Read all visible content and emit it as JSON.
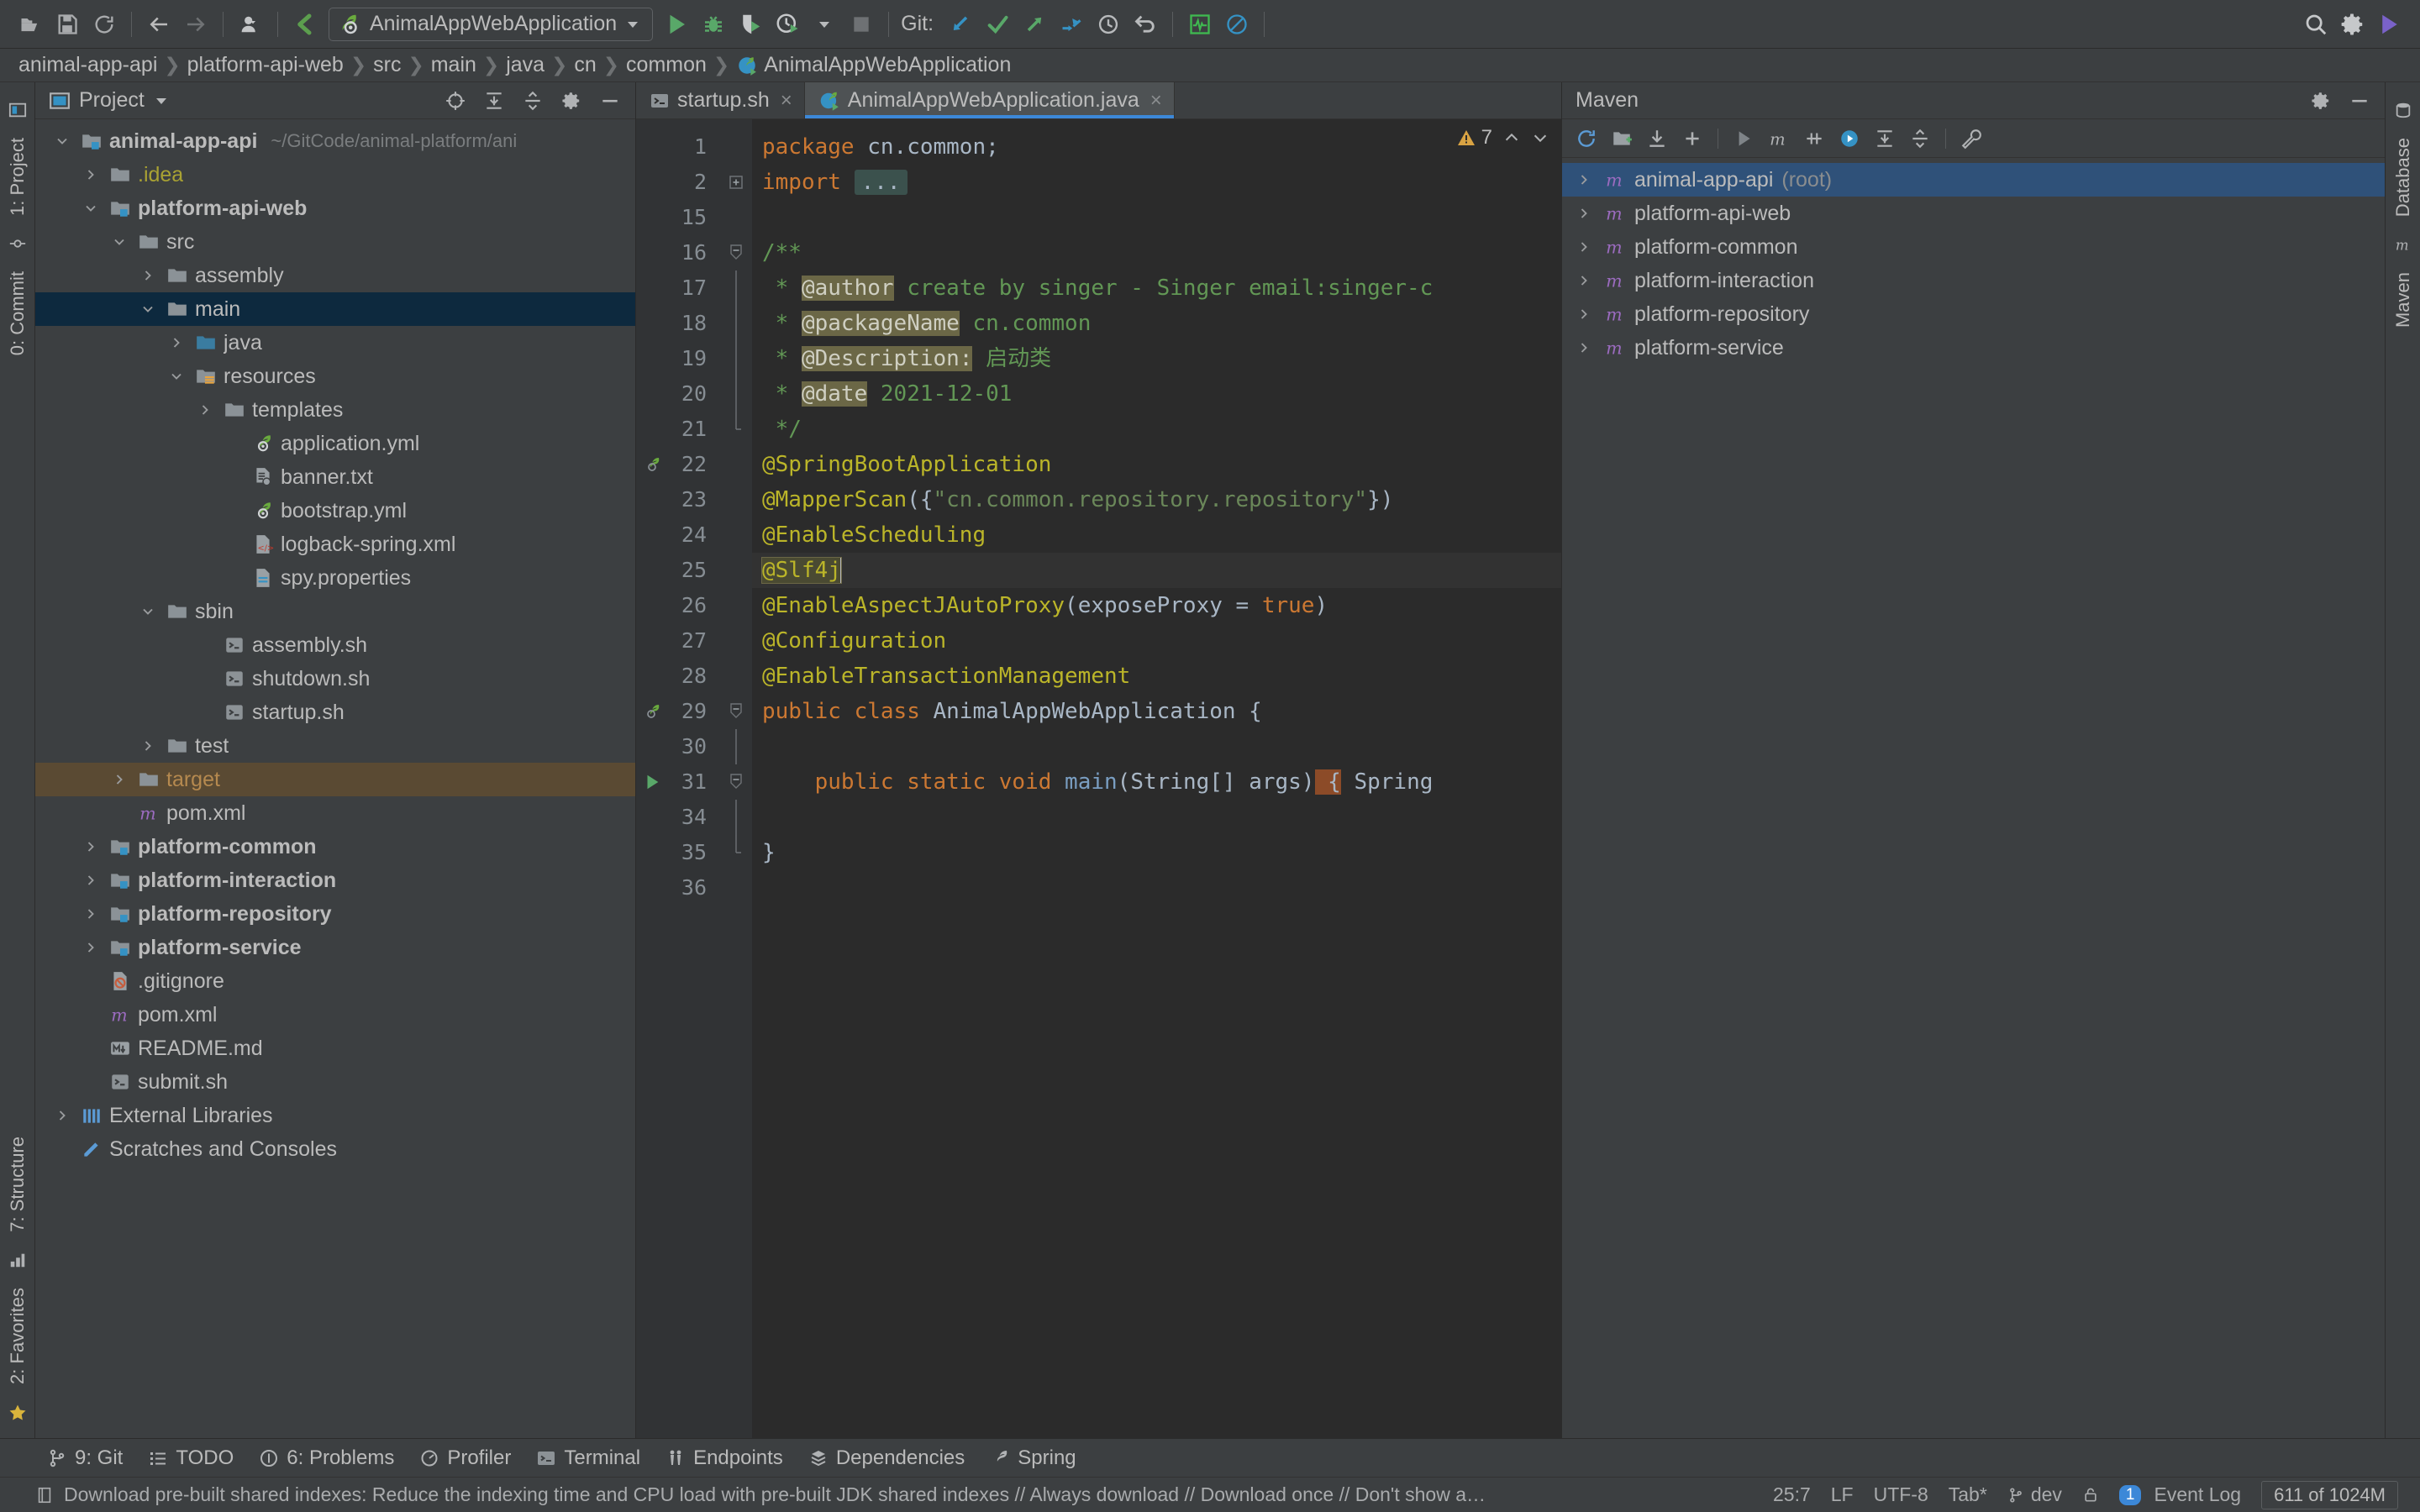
{
  "toolbar": {
    "icons": [
      "open-folder-icon",
      "save-icon",
      "sync-icon",
      "back-arrow-icon",
      "forward-arrow-icon",
      "user-avatar-icon",
      "vcs-update-icon"
    ],
    "run_config": "AnimalAppWebApplication",
    "run_label": "Run",
    "debug_label": "Debug",
    "coverage_label": "Run with Coverage",
    "profile_label": "Profile",
    "stop_label": "Stop",
    "git_label": "Git:",
    "search_label": "Search Everywhere",
    "settings_label": "Settings",
    "updates_label": "Updates"
  },
  "breadcrumb": {
    "items": [
      {
        "label": "animal-app-api",
        "icon": ""
      },
      {
        "label": "platform-api-web",
        "icon": ""
      },
      {
        "label": "src",
        "icon": ""
      },
      {
        "label": "main",
        "icon": ""
      },
      {
        "label": "java",
        "icon": ""
      },
      {
        "label": "cn",
        "icon": ""
      },
      {
        "label": "common",
        "icon": ""
      },
      {
        "label": "AnimalAppWebApplication",
        "icon": "spring-class-icon"
      }
    ],
    "separator": "❯"
  },
  "left_strip": {
    "project_label": "1: Project",
    "commit_label": "0: Commit",
    "structure_label": "7: Structure",
    "favorites_label": "2: Favorites"
  },
  "right_strip": {
    "database_label": "Database",
    "maven_label": "Maven"
  },
  "project_panel": {
    "title": "Project",
    "toolbar_icons": [
      "locate-icon",
      "expand-all-icon",
      "collapse-all-icon",
      "gear-icon",
      "hide-icon"
    ],
    "tree": [
      {
        "label": "animal-app-api",
        "sub": "~/GitCode/animal-platform/ani",
        "depth": 0,
        "twisty": "open",
        "icon": "module-folder-icon",
        "bold": true
      },
      {
        "label": ".idea",
        "sub": "",
        "depth": 1,
        "twisty": "closed",
        "icon": "folder-icon",
        "color": "yellow"
      },
      {
        "label": "platform-api-web",
        "sub": "",
        "depth": 1,
        "twisty": "open",
        "icon": "module-folder-icon",
        "bold": true
      },
      {
        "label": "src",
        "sub": "",
        "depth": 2,
        "twisty": "open",
        "icon": "folder-icon"
      },
      {
        "label": "assembly",
        "sub": "",
        "depth": 3,
        "twisty": "closed",
        "icon": "folder-icon"
      },
      {
        "label": "main",
        "sub": "",
        "depth": 3,
        "twisty": "open",
        "icon": "folder-icon",
        "selected": true
      },
      {
        "label": "java",
        "sub": "",
        "depth": 4,
        "twisty": "closed",
        "icon": "source-folder-icon"
      },
      {
        "label": "resources",
        "sub": "",
        "depth": 4,
        "twisty": "open",
        "icon": "resource-folder-icon"
      },
      {
        "label": "templates",
        "sub": "",
        "depth": 5,
        "twisty": "closed",
        "icon": "folder-icon"
      },
      {
        "label": "application.yml",
        "sub": "",
        "depth": 6,
        "twisty": "none",
        "icon": "spring-yaml-icon"
      },
      {
        "label": "banner.txt",
        "sub": "",
        "depth": 6,
        "twisty": "none",
        "icon": "text-file-icon"
      },
      {
        "label": "bootstrap.yml",
        "sub": "",
        "depth": 6,
        "twisty": "none",
        "icon": "spring-yaml-icon"
      },
      {
        "label": "logback-spring.xml",
        "sub": "",
        "depth": 6,
        "twisty": "none",
        "icon": "xml-file-icon"
      },
      {
        "label": "spy.properties",
        "sub": "",
        "depth": 6,
        "twisty": "none",
        "icon": "properties-file-icon"
      },
      {
        "label": "sbin",
        "sub": "",
        "depth": 3,
        "twisty": "open",
        "icon": "folder-icon"
      },
      {
        "label": "assembly.sh",
        "sub": "",
        "depth": 5,
        "twisty": "none",
        "icon": "shell-file-icon"
      },
      {
        "label": "shutdown.sh",
        "sub": "",
        "depth": 5,
        "twisty": "none",
        "icon": "shell-file-icon"
      },
      {
        "label": "startup.sh",
        "sub": "",
        "depth": 5,
        "twisty": "none",
        "icon": "shell-file-icon"
      },
      {
        "label": "test",
        "sub": "",
        "depth": 3,
        "twisty": "closed",
        "icon": "folder-icon"
      },
      {
        "label": "target",
        "sub": "",
        "depth": 2,
        "twisty": "closed",
        "icon": "folder-icon",
        "color": "orange",
        "target_selected": true
      },
      {
        "label": "pom.xml",
        "sub": "",
        "depth": 2,
        "twisty": "none",
        "icon": "maven-file-icon"
      },
      {
        "label": "platform-common",
        "sub": "",
        "depth": 1,
        "twisty": "closed",
        "icon": "module-folder-icon",
        "bold": true
      },
      {
        "label": "platform-interaction",
        "sub": "",
        "depth": 1,
        "twisty": "closed",
        "icon": "module-folder-icon",
        "bold": true
      },
      {
        "label": "platform-repository",
        "sub": "",
        "depth": 1,
        "twisty": "closed",
        "icon": "module-folder-icon",
        "bold": true
      },
      {
        "label": "platform-service",
        "sub": "",
        "depth": 1,
        "twisty": "closed",
        "icon": "module-folder-icon",
        "bold": true
      },
      {
        "label": ".gitignore",
        "sub": "",
        "depth": 1,
        "twisty": "none",
        "icon": "gitignore-file-icon"
      },
      {
        "label": "pom.xml",
        "sub": "",
        "depth": 1,
        "twisty": "none",
        "icon": "maven-file-icon"
      },
      {
        "label": "README.md",
        "sub": "",
        "depth": 1,
        "twisty": "none",
        "icon": "markdown-file-icon"
      },
      {
        "label": "submit.sh",
        "sub": "",
        "depth": 1,
        "twisty": "none",
        "icon": "shell-file-icon"
      },
      {
        "label": "External Libraries",
        "sub": "",
        "depth": 0,
        "twisty": "closed",
        "icon": "libraries-icon"
      },
      {
        "label": "Scratches and Consoles",
        "sub": "",
        "depth": 0,
        "twisty": "none",
        "icon": "scratches-icon"
      }
    ]
  },
  "editor": {
    "tabs": [
      {
        "label": "startup.sh",
        "icon": "shell-file-icon",
        "active": false
      },
      {
        "label": "AnimalAppWebApplication.java",
        "icon": "spring-class-icon",
        "active": true
      }
    ],
    "close_glyph": "×",
    "inspection": {
      "warning_count": "7",
      "up_glyph": "⌃",
      "down_glyph": "⌄"
    },
    "lines": [
      {
        "no": "1",
        "fold": "none",
        "mark": "",
        "tokens": [
          {
            "t": "package ",
            "c": "kw"
          },
          {
            "t": "cn.common;",
            "c": "pln"
          }
        ]
      },
      {
        "no": "2",
        "fold": "plus",
        "mark": "",
        "tokens": [
          {
            "t": "import ",
            "c": "kw"
          },
          {
            "t": "...",
            "c": "fold-box"
          }
        ]
      },
      {
        "no": "15",
        "fold": "none",
        "mark": "",
        "tokens": []
      },
      {
        "no": "16",
        "fold": "minus",
        "mark": "",
        "tokens": [
          {
            "t": "/**",
            "c": "doc"
          }
        ]
      },
      {
        "no": "17",
        "fold": "bar",
        "mark": "",
        "tokens": [
          {
            "t": " * ",
            "c": "doc"
          },
          {
            "t": "@author",
            "c": "tag"
          },
          {
            "t": " create by singer - Singer email:singer-c",
            "c": "doc"
          }
        ]
      },
      {
        "no": "18",
        "fold": "bar",
        "mark": "",
        "tokens": [
          {
            "t": " * ",
            "c": "doc"
          },
          {
            "t": "@packageName",
            "c": "tag"
          },
          {
            "t": " cn.common",
            "c": "doc"
          }
        ]
      },
      {
        "no": "19",
        "fold": "bar",
        "mark": "",
        "tokens": [
          {
            "t": " * ",
            "c": "doc"
          },
          {
            "t": "@Description:",
            "c": "tag"
          },
          {
            "t": " 启动类",
            "c": "doc"
          }
        ]
      },
      {
        "no": "20",
        "fold": "bar",
        "mark": "",
        "tokens": [
          {
            "t": " * ",
            "c": "doc"
          },
          {
            "t": "@date",
            "c": "tag"
          },
          {
            "t": " 2021-12-01",
            "c": "doc"
          }
        ]
      },
      {
        "no": "21",
        "fold": "end",
        "mark": "",
        "tokens": [
          {
            "t": " */",
            "c": "doc"
          }
        ]
      },
      {
        "no": "22",
        "fold": "none",
        "mark": "spring-bean",
        "tokens": [
          {
            "t": "@SpringBootApplication",
            "c": "ann"
          }
        ]
      },
      {
        "no": "23",
        "fold": "none",
        "mark": "",
        "tokens": [
          {
            "t": "@MapperScan",
            "c": "ann"
          },
          {
            "t": "({",
            "c": "pln"
          },
          {
            "t": "\"cn.common.repository.repository\"",
            "c": "str"
          },
          {
            "t": "})",
            "c": "pln"
          }
        ]
      },
      {
        "no": "24",
        "fold": "none",
        "mark": "",
        "tokens": [
          {
            "t": "@EnableScheduling",
            "c": "ann"
          }
        ]
      },
      {
        "no": "25",
        "fold": "none",
        "mark": "",
        "tokens": [
          {
            "t": "@Slf4j",
            "c": "ann-sel"
          },
          {
            "t": "",
            "c": "caret"
          }
        ],
        "current": true
      },
      {
        "no": "26",
        "fold": "none",
        "mark": "",
        "tokens": [
          {
            "t": "@EnableAspectJAutoProxy",
            "c": "ann"
          },
          {
            "t": "(",
            "c": "pln"
          },
          {
            "t": "exposeProxy",
            "c": "pln"
          },
          {
            "t": " = ",
            "c": "pln"
          },
          {
            "t": "true",
            "c": "kw"
          },
          {
            "t": ")",
            "c": "pln"
          }
        ]
      },
      {
        "no": "27",
        "fold": "none",
        "mark": "",
        "tokens": [
          {
            "t": "@Configuration",
            "c": "ann"
          }
        ]
      },
      {
        "no": "28",
        "fold": "none",
        "mark": "",
        "tokens": [
          {
            "t": "@EnableTransactionManagement",
            "c": "ann"
          }
        ]
      },
      {
        "no": "29",
        "fold": "minus",
        "mark": "spring-run",
        "tokens": [
          {
            "t": "public ",
            "c": "kw"
          },
          {
            "t": "class ",
            "c": "kw"
          },
          {
            "t": "AnimalAppWebApplication",
            "c": "cls"
          },
          {
            "t": " {",
            "c": "pln"
          }
        ]
      },
      {
        "no": "30",
        "fold": "bar",
        "mark": "",
        "tokens": []
      },
      {
        "no": "31",
        "fold": "minus2",
        "mark": "run",
        "tokens": [
          {
            "t": "    public ",
            "c": "kw"
          },
          {
            "t": "static ",
            "c": "kw"
          },
          {
            "t": "void ",
            "c": "kw"
          },
          {
            "t": "main",
            "c": "fn"
          },
          {
            "t": "(",
            "c": "pln"
          },
          {
            "t": "String",
            "c": "cls"
          },
          {
            "t": "[] ",
            "c": "pln"
          },
          {
            "t": "args",
            "c": "pln"
          },
          {
            "t": ")",
            "c": "pln"
          },
          {
            "t": " {",
            "c": "brk-o"
          },
          {
            "t": " Spring",
            "c": "cls"
          }
        ]
      },
      {
        "no": "34",
        "fold": "bar",
        "mark": "",
        "tokens": []
      },
      {
        "no": "35",
        "fold": "end",
        "mark": "",
        "tokens": [
          {
            "t": "}",
            "c": "pln"
          }
        ]
      },
      {
        "no": "36",
        "fold": "none",
        "mark": "",
        "tokens": []
      }
    ]
  },
  "maven_panel": {
    "title": "Maven",
    "toolbar_icons": [
      "reload-icon",
      "add-folder-icon",
      "download-icon",
      "plus-icon",
      "run-icon",
      "maven-m-icon",
      "skip-tests-icon",
      "execute-goal-icon",
      "expand-icon",
      "collapse-icon",
      "settings-wrench-icon"
    ],
    "settings_label": "Settings",
    "hide_label": "Hide",
    "tree": [
      {
        "label": "animal-app-api",
        "sub": "(root)",
        "selected": true
      },
      {
        "label": "platform-api-web",
        "sub": ""
      },
      {
        "label": "platform-common",
        "sub": ""
      },
      {
        "label": "platform-interaction",
        "sub": ""
      },
      {
        "label": "platform-repository",
        "sub": ""
      },
      {
        "label": "platform-service",
        "sub": ""
      }
    ]
  },
  "bottom_bar": {
    "items": [
      {
        "label": "9: Git",
        "icon": "git-branch-icon",
        "mnemonic": "9"
      },
      {
        "label": "TODO",
        "icon": "todo-icon",
        "mnemonic": ""
      },
      {
        "label": "6: Problems",
        "icon": "problems-icon",
        "mnemonic": "6"
      },
      {
        "label": "Profiler",
        "icon": "profiler-icon",
        "mnemonic": ""
      },
      {
        "label": "Terminal",
        "icon": "terminal-icon",
        "mnemonic": ""
      },
      {
        "label": "Endpoints",
        "icon": "endpoints-icon",
        "mnemonic": ""
      },
      {
        "label": "Dependencies",
        "icon": "dependencies-icon",
        "mnemonic": ""
      },
      {
        "label": "Spring",
        "icon": "spring-icon",
        "mnemonic": ""
      }
    ]
  },
  "status_bar": {
    "message": "Download pre-built shared indexes: Reduce the indexing time and CPU load with pre-built JDK shared indexes // Always download // Download once // Don't show again // Configure... (moments ago",
    "caret_position": "25:7",
    "line_separator": "LF",
    "encoding": "UTF-8",
    "indent": "Tab*",
    "branch": "dev",
    "event_log": "Event Log",
    "event_count": "1",
    "memory": "611 of 1024M",
    "lock_icon": "lock-icon"
  }
}
